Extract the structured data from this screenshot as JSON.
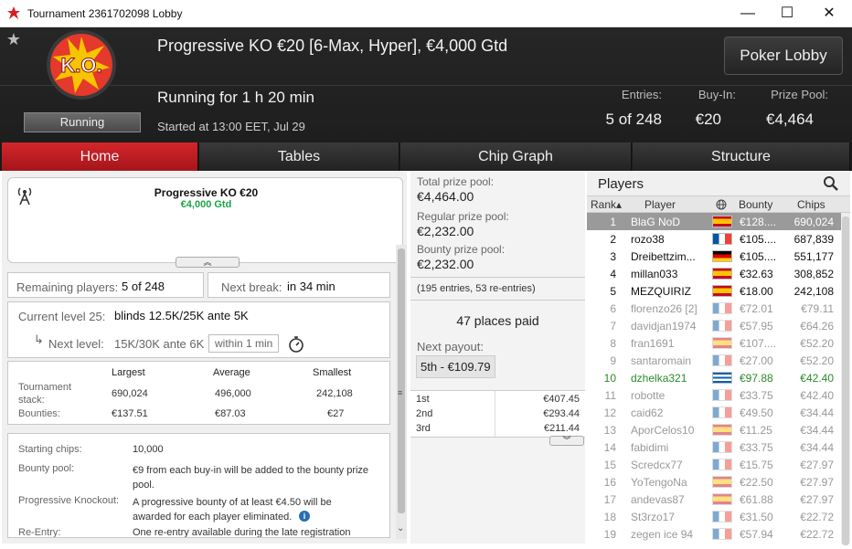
{
  "window": {
    "title": "Tournament 2361702098 Lobby",
    "minimize": "—",
    "maximize": "☐",
    "close": "✕"
  },
  "header": {
    "name": "Progressive KO €20 [6-Max, Hyper], €4,000 Gtd",
    "logo_text": "K.O.",
    "status": "Running",
    "running": "Running for 1 h 20 min",
    "started": "Started at 13:00 EET, Jul 29",
    "lobby_button": "Poker Lobby",
    "entries_label": "Entries:",
    "entries_value": "5 of 248",
    "buyin_label": "Buy-In:",
    "buyin_value": "€20",
    "prizepool_label": "Prize Pool:",
    "prizepool_value": "€4,464"
  },
  "tabs": [
    "Home",
    "Tables",
    "Chip Graph",
    "Structure"
  ],
  "home": {
    "banner_title": "Progressive KO €20",
    "banner_sub": "€4,000 Gtd",
    "collapse": "︽",
    "remaining_label": "Remaining players:",
    "remaining_value": "5 of 248",
    "break_label": "Next break:",
    "break_value": "in 34 min",
    "level_label": "Current level 25:",
    "level_value": "blinds 12.5K/25K ante 5K",
    "next_label": "Next level:",
    "next_value": "15K/30K ante 6K",
    "next_time": "within 1 min",
    "stack_headers": [
      "Largest",
      "Average",
      "Smallest"
    ],
    "stack_label": "Tournament stack:",
    "stack_values": [
      "690,024",
      "496,000",
      "242,108"
    ],
    "bounties_label": "Bounties:",
    "bounty_values": [
      "€137.51",
      "€87.03",
      "€27"
    ],
    "info": [
      {
        "label": "Starting chips:",
        "value": "10,000"
      },
      {
        "label": "Bounty pool:",
        "value": "€9 from each buy-in will be added to the bounty prize pool."
      },
      {
        "label": "Progressive Knockout:",
        "value": "A progressive bounty of at least €4.50 will be awarded for each player eliminated."
      },
      {
        "label": "Re-Entry:",
        "value": "One re-entry available during the late registration"
      }
    ]
  },
  "prizes": {
    "total_label": "Total prize pool:",
    "total_value": "€4,464.00",
    "regular_label": "Regular prize pool:",
    "regular_value": "€2,232.00",
    "bounty_label": "Bounty prize pool:",
    "bounty_value": "€2,232.00",
    "entries_note": "(195 entries, 53 re-entries)",
    "places_paid": "47 places paid",
    "next_payout_label": "Next payout:",
    "next_payout_value": "5th - €109.79",
    "payouts": [
      {
        "place": "1st",
        "amount": "€407.45"
      },
      {
        "place": "2nd",
        "amount": "€293.44"
      },
      {
        "place": "3rd",
        "amount": "€211.44"
      }
    ],
    "expand": "︾"
  },
  "players": {
    "title": "Players",
    "columns": {
      "rank": "Rank▴",
      "player": "Player",
      "bounty": "Bounty",
      "chips": "Chips"
    },
    "rows": [
      {
        "rank": "1",
        "name": "BlaG NoD",
        "bounty": "€128....",
        "chips": "690,024",
        "flag": "es",
        "state": "selected"
      },
      {
        "rank": "2",
        "name": "rozo38",
        "bounty": "€105....",
        "chips": "687,839",
        "flag": "fr",
        "state": "active"
      },
      {
        "rank": "3",
        "name": "Dreibettzim...",
        "bounty": "€105....",
        "chips": "551,177",
        "flag": "de",
        "state": "active"
      },
      {
        "rank": "4",
        "name": "millan033",
        "bounty": "€32.63",
        "chips": "308,852",
        "flag": "es",
        "state": "active"
      },
      {
        "rank": "5",
        "name": "MEZQUIRIZ",
        "bounty": "€18.00",
        "chips": "242,108",
        "flag": "es",
        "state": "active"
      },
      {
        "rank": "6",
        "name": "florenzo26 [2]",
        "bounty": "€72.01",
        "chips": "€79.11",
        "flag": "fr",
        "state": "out"
      },
      {
        "rank": "7",
        "name": "davidjan1974",
        "bounty": "€57.95",
        "chips": "€64.26",
        "flag": "fr",
        "state": "out"
      },
      {
        "rank": "8",
        "name": "fran1691",
        "bounty": "€107....",
        "chips": "€52.20",
        "flag": "es",
        "state": "out"
      },
      {
        "rank": "9",
        "name": "santaromain",
        "bounty": "€27.00",
        "chips": "€52.20",
        "flag": "fr",
        "state": "out"
      },
      {
        "rank": "10",
        "name": "dzhelka321",
        "bounty": "€97.88",
        "chips": "€42.40",
        "flag": "gr",
        "state": "hero"
      },
      {
        "rank": "11",
        "name": "robotte",
        "bounty": "€33.75",
        "chips": "€42.40",
        "flag": "fr",
        "state": "out"
      },
      {
        "rank": "12",
        "name": "caid62",
        "bounty": "€49.50",
        "chips": "€34.44",
        "flag": "fr",
        "state": "out"
      },
      {
        "rank": "13",
        "name": "AporCelos10",
        "bounty": "€11.25",
        "chips": "€34.44",
        "flag": "es",
        "state": "out"
      },
      {
        "rank": "14",
        "name": "fabidimi",
        "bounty": "€33.75",
        "chips": "€34.44",
        "flag": "fr",
        "state": "out"
      },
      {
        "rank": "15",
        "name": "Scredcx77",
        "bounty": "€15.75",
        "chips": "€27.97",
        "flag": "fr",
        "state": "out"
      },
      {
        "rank": "16",
        "name": "YoTengoNa",
        "bounty": "€22.50",
        "chips": "€27.97",
        "flag": "es",
        "state": "out"
      },
      {
        "rank": "17",
        "name": "andevas87",
        "bounty": "€61.88",
        "chips": "€27.97",
        "flag": "es",
        "state": "out"
      },
      {
        "rank": "18",
        "name": "St3rzo17",
        "bounty": "€31.50",
        "chips": "€22.72",
        "flag": "fr",
        "state": "out"
      },
      {
        "rank": "19",
        "name": "zegen ice 94",
        "bounty": "€57.94",
        "chips": "€22.72",
        "flag": "fr",
        "state": "out"
      }
    ]
  },
  "colors": {
    "accent": "#c41e24",
    "hero": "#2a8a2a",
    "gtd": "#1aa34a",
    "header": "#222222"
  }
}
